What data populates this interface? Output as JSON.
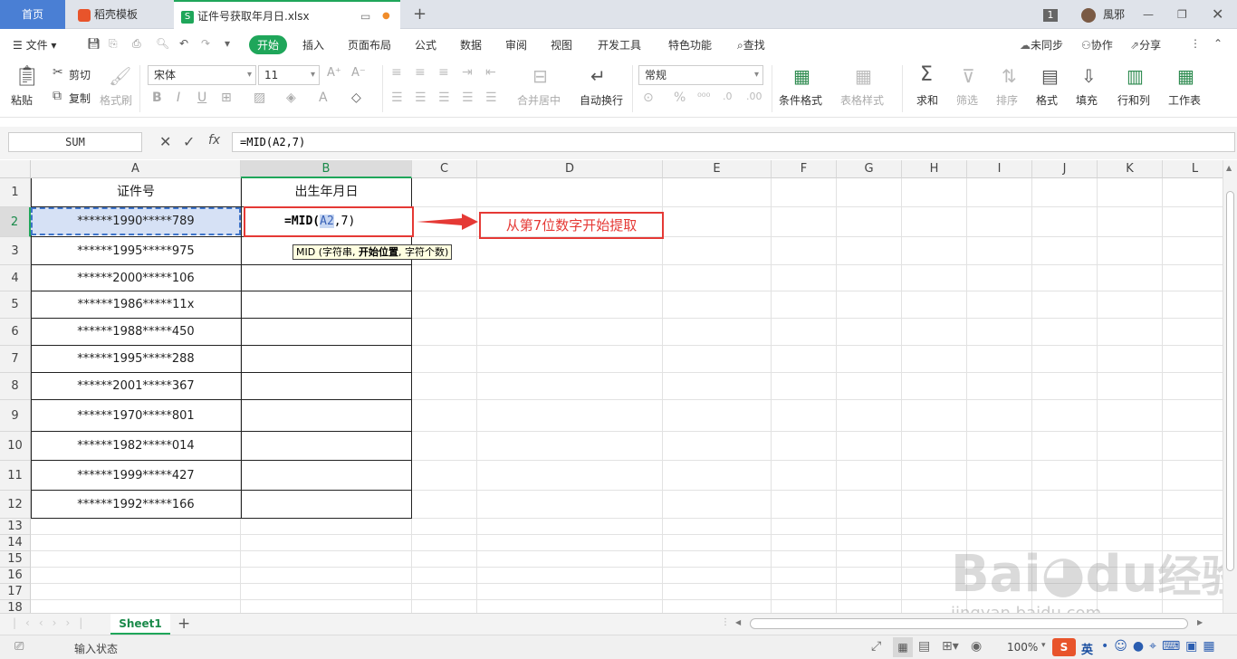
{
  "tabs": {
    "home": "首页",
    "template": "稻壳模板",
    "document": "证件号获取年月日.xlsx"
  },
  "window": {
    "badge": "1",
    "user": "風邪"
  },
  "menu": {
    "file": "文件",
    "items": [
      "开始",
      "插入",
      "页面布局",
      "公式",
      "数据",
      "审阅",
      "视图",
      "开发工具",
      "特色功能"
    ],
    "search": "查找",
    "sync": "未同步",
    "collab": "协作",
    "share": "分享"
  },
  "ribbon": {
    "paste": "粘贴",
    "cut": "剪切",
    "copy": "复制",
    "format_painter": "格式刷",
    "font_name": "宋体",
    "font_size": "11",
    "merge_center": "合并居中",
    "wrap_text": "自动换行",
    "number_format": "常规",
    "cond_format": "条件格式",
    "table_style": "表格样式",
    "sum": "求和",
    "filter": "筛选",
    "sort": "排序",
    "format": "格式",
    "fill": "填充",
    "row_col": "行和列",
    "worksheet": "工作表"
  },
  "formula_bar": {
    "name_box": "SUM",
    "fx": "fx",
    "formula": "=MID(A2,7)"
  },
  "columns": [
    "A",
    "B",
    "C",
    "D",
    "E",
    "F",
    "G",
    "H",
    "I",
    "J",
    "K",
    "L"
  ],
  "rows": [
    "1",
    "2",
    "3",
    "4",
    "5",
    "6",
    "7",
    "8",
    "9",
    "10",
    "11",
    "12",
    "13",
    "14",
    "15",
    "16",
    "17",
    "18"
  ],
  "table": {
    "header_a": "证件号",
    "header_b": "出生年月日",
    "ids": [
      "******1990*****789",
      "******1995*****975",
      "******2000*****106",
      "******1986*****11x",
      "******1988*****450",
      "******1995*****288",
      "******2001*****367",
      "******1970*****801",
      "******1982*****014",
      "******1999*****427",
      "******1992*****166"
    ]
  },
  "editing": {
    "prefix": "=MID(",
    "ref": "A2",
    "suffix": ",7)",
    "tooltip_fn": "MID",
    "tooltip_args": "(字符串,",
    "tooltip_bold": "开始位置",
    "tooltip_end": ", 字符个数)"
  },
  "annotation": {
    "text": "从第7位数字开始提取",
    "color": "#e53935"
  },
  "sheet": {
    "name": "Sheet1"
  },
  "status": {
    "mode": "输入状态",
    "zoom": "100%",
    "ime": "英"
  },
  "watermark": {
    "brand": "Bai",
    "brand2": "du",
    "cn": "经验",
    "url": "jingyan.baidu.com"
  }
}
